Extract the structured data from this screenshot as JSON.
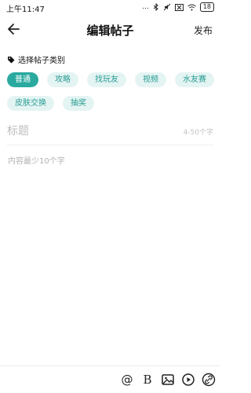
{
  "status_bar": {
    "time": "上午11:47",
    "indicators": "...",
    "battery": "18"
  },
  "header": {
    "title": "编辑帖子",
    "publish_label": "发布"
  },
  "category": {
    "label": "选择帖子类别",
    "options": [
      "普通",
      "攻略",
      "找玩友",
      "视频",
      "水友赛",
      "皮肤交换",
      "抽奖"
    ],
    "selected": "普通"
  },
  "title_field": {
    "placeholder": "标题",
    "count_hint": "4-50个字"
  },
  "content_field": {
    "placeholder": "内容最少10个字"
  },
  "toolbar": {
    "mention_glyph": "@",
    "bold_glyph": "B"
  },
  "colors": {
    "accent": "#2aaa9f",
    "chip_bg": "#e4f4f3"
  }
}
